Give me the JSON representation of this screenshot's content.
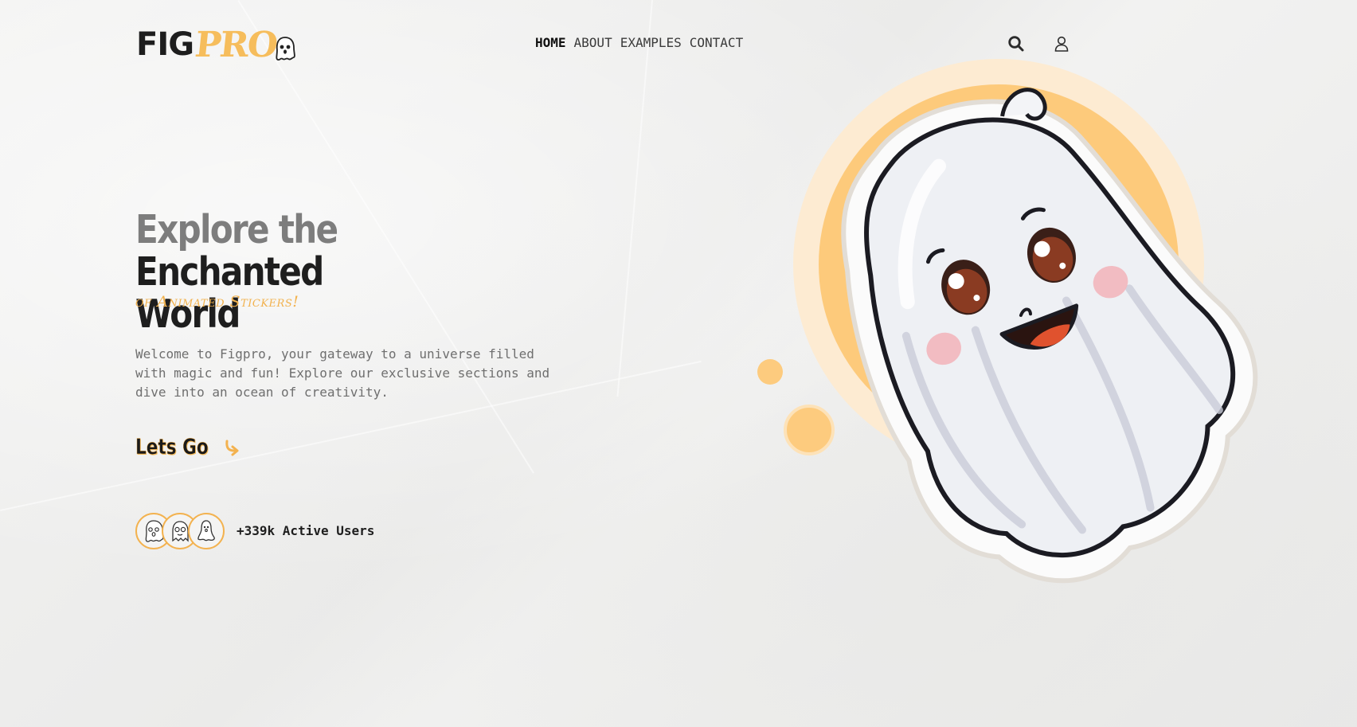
{
  "brand": {
    "logo_part1": "FIG",
    "logo_part2": "PRO",
    "logo_icon": "ghost-icon"
  },
  "nav": {
    "items": [
      {
        "label": "HOME",
        "active": true
      },
      {
        "label": "ABOUT",
        "active": false
      },
      {
        "label": "EXAMPLES",
        "active": false
      },
      {
        "label": "CONTACT",
        "active": false
      }
    ]
  },
  "header_icons": {
    "search": "search-icon",
    "account": "user-icon"
  },
  "hero": {
    "title_part1": "Explore the",
    "title_part2": "Enchanted",
    "title_part3": "World",
    "subtitle": "of Animated Stickers!",
    "description": "Welcome to Figpro, your gateway to a universe filled with magic and fun! Explore our exclusive sections and dive into an ocean of creativity.",
    "cta_label": "Lets Go",
    "cta_icon": "curved-arrow-icon",
    "users_text": "+339k Active Users",
    "avatar_icons": [
      "ghost-icon",
      "ghost-icon",
      "ghost-icon"
    ]
  },
  "colors": {
    "accent": "#f6bd5c",
    "accent_light": "#fde8c6",
    "text_dark": "#1e1e1e",
    "text_grey": "#7d7d7d",
    "background": "#f0f0ef"
  }
}
